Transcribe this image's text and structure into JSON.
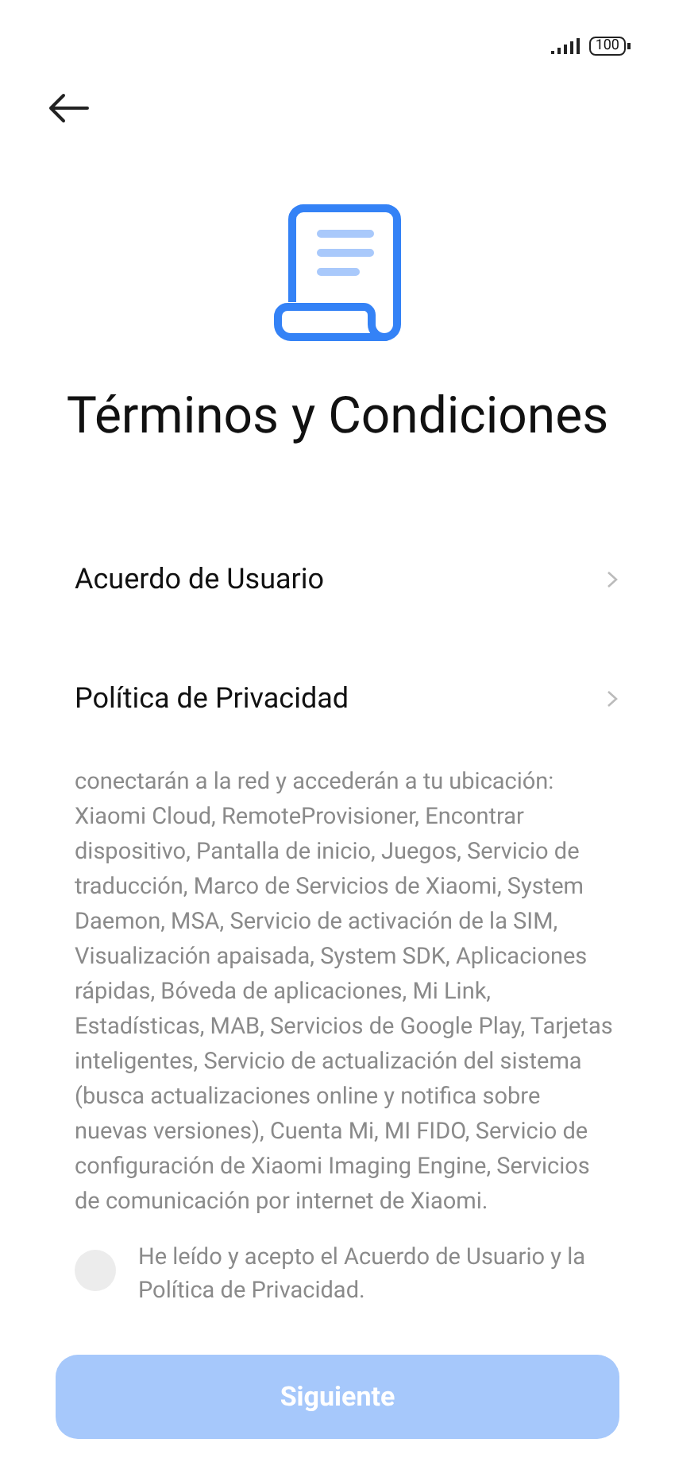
{
  "status_bar": {
    "battery": "100"
  },
  "title": "Términos y Condiciones",
  "links": [
    {
      "label": "Acuerdo de Usuario"
    },
    {
      "label": "Política de Privacidad"
    }
  ],
  "description": "conectarán a la red y accederán a tu ubicación: Xiaomi Cloud, RemoteProvisioner, Encontrar dispositivo, Pantalla de inicio, Juegos, Servicio de traducción, Marco de Servicios de Xiaomi, System Daemon, MSA, Servicio de activación de la SIM, Visualización apaisada, System SDK, Aplicaciones rápidas, Bóveda de aplicaciones, Mi Link, Estadísticas, MAB, Servicios de Google Play, Tarjetas inteligentes, Servicio de actualización del sistema (busca actualizaciones online y notifica sobre nuevas versiones), Cuenta Mi, MI FIDO, Servicio de configuración de Xiaomi Imaging Engine, Servicios de comunicación por internet de Xiaomi.",
  "agreement": {
    "label": "He leído y acepto el Acuerdo de Usuario y la Política de Privacidad.",
    "checked": false
  },
  "next_button": {
    "label": "Siguiente",
    "disabled": true
  }
}
